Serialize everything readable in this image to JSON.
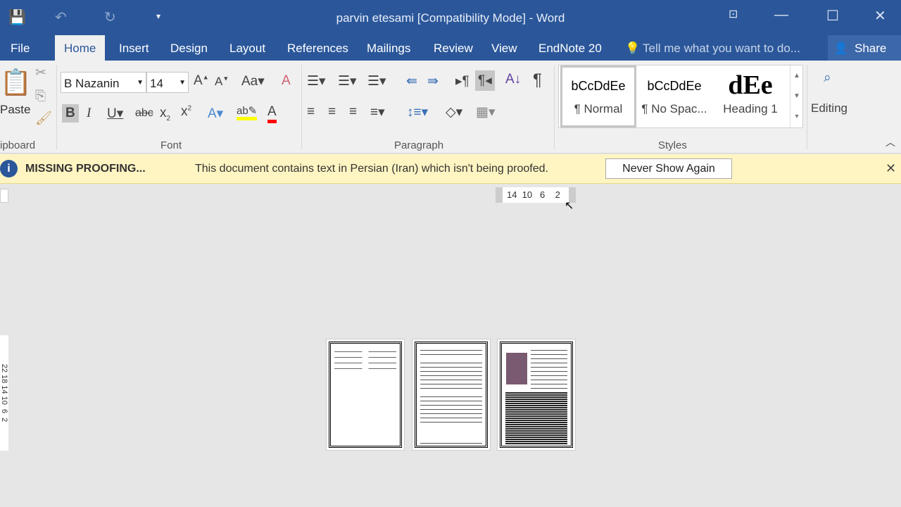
{
  "window": {
    "title": "parvin etesami [Compatibility Mode] - Word"
  },
  "tabs": [
    "File",
    "Home",
    "Insert",
    "Design",
    "Layout",
    "References",
    "Mailings",
    "Review",
    "View",
    "EndNote 20"
  ],
  "active_tab": "Home",
  "tell_me": "Tell me what you want to do...",
  "share": "Share",
  "clipboard": {
    "paste": "Paste",
    "group": "ipboard"
  },
  "font": {
    "name": "B Nazanin",
    "size": "14",
    "group": "Font"
  },
  "paragraph": {
    "group": "Paragraph"
  },
  "styles": {
    "group": "Styles",
    "items": [
      {
        "preview": "bCcDdEe",
        "label": "¶ Normal"
      },
      {
        "preview": "bCcDdEe",
        "label": "¶ No Spac..."
      },
      {
        "preview": "dEe",
        "label": "Heading 1"
      }
    ]
  },
  "editing": {
    "label": "Editing"
  },
  "message_bar": {
    "title": "MISSING PROOFING...",
    "text": "This document contains text in Persian (Iran) which isn't being proofed.",
    "button": "Never Show Again"
  },
  "ruler": {
    "horizontal": "14  10   6    2",
    "vertical": "22 18 14 10  6  2"
  },
  "colors": {
    "accent": "#2b579a",
    "message": "#fff5c2",
    "highlight": "#ffff00",
    "font_color": "#ff0000"
  }
}
